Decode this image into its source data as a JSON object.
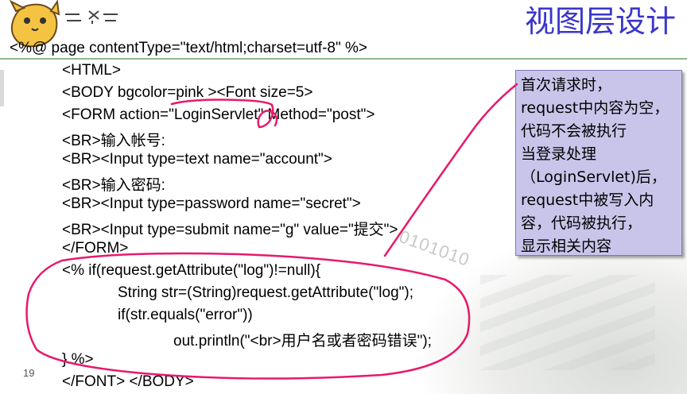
{
  "slide": {
    "title": "视图层设计",
    "page_number": "19",
    "code_lines": [
      "<%@ page contentType=\"text/html;charset=utf-8\" %>",
      "<HTML>",
      "<BODY bgcolor=pink ><Font size=5>",
      "<FORM action=\"LoginServlet\" Method=\"post\">",
      "<BR>输入帐号:",
      "<BR><Input type=text name=\"account\">",
      "<BR>输入密码:",
      "<BR><Input type=password name=\"secret\">",
      "<BR><Input type=submit name=\"g\" value=\"提交\">",
      "</FORM>",
      "<% if(request.getAttribute(\"log\")!=null){",
      "String str=(String)request.getAttribute(\"log\");",
      "if(str.equals(\"error\"))",
      "out.println(\"<br>用户名或者密码错误\");",
      "} %>",
      "</FONT> </BODY>"
    ],
    "callout_lines": [
      "首次请求时，",
      "request中内容为空，",
      "代码不会被执行",
      "当登录处理",
      "（LoginServlet)后，",
      "request中被写入内",
      "容，代码被执行，",
      "显示相关内容"
    ],
    "background_text": "0101010"
  },
  "colors": {
    "title": "#3a36c9",
    "callout_fill": "#c9c5ea",
    "annotation_stroke": "#e8196a",
    "rule": "#8db88d"
  }
}
